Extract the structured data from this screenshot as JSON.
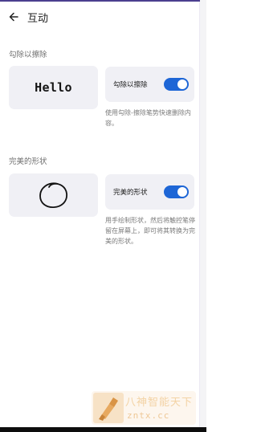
{
  "header": {
    "back_icon": "arrow-left-icon",
    "title": "互动"
  },
  "sections": [
    {
      "title": "勾除以擦除",
      "preview_text": "Hello",
      "toggle_label": "勾除以擦除",
      "toggle_on": true,
      "description": "使用勾除-擦除笔势快速删除内容。"
    },
    {
      "title": "完美的形状",
      "preview_icon": "hand-drawn-circle-icon",
      "toggle_label": "完美的形状",
      "toggle_on": true,
      "description": "用手绘制形状，然后将触控笔停留在屏幕上，即可将其转换为完美的形状。"
    }
  ],
  "colors": {
    "accent": "#1e66d6",
    "card_bg": "#f0f0f5",
    "top_accent": "#4b3f8f"
  },
  "watermark": {
    "logo_icon": "brush-logo-icon",
    "title": "八神智能天下",
    "url": "zntx.cc"
  }
}
